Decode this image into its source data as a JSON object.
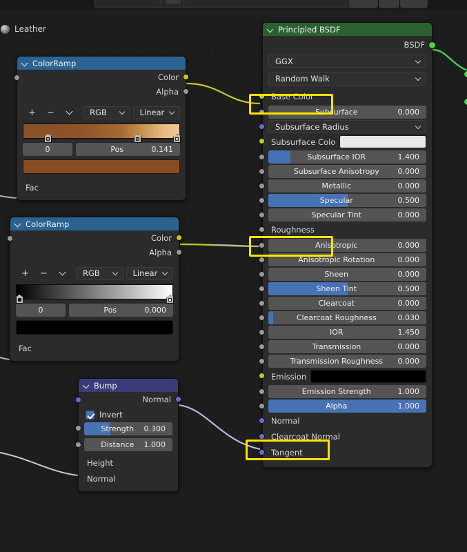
{
  "app": {
    "editor": "shader-node-editor"
  },
  "breadcrumb": {
    "material": "Leather",
    "icon": "material-ball-icon"
  },
  "colors": {
    "header_colorramp": "#2a6391",
    "header_bsdf": "#2b6130",
    "header_bump": "#3b3b7a",
    "slider_fill": "#4772b3",
    "highlight": "#ffe400",
    "socket_color": "#c7c729",
    "socket_gray": "#9a9a9a",
    "socket_green": "#4dcf53",
    "socket_vector": "#6b6bd8",
    "ramp1_start": "#8a5227",
    "ramp1_mid": "#8a5227",
    "ramp1_end": "#f0c893",
    "ramp2_start": "#000000",
    "ramp2_end": "#ffffff",
    "swatch1": "#8a4d23",
    "swatch2": "#000000",
    "emission_swatch": "#000000",
    "subsurface_color_swatch": "#e8e8e8"
  },
  "nodes": {
    "colorramp_top": {
      "title": "ColorRamp",
      "outputs": [
        {
          "label": "Color",
          "socket": "color-socket"
        },
        {
          "label": "Alpha",
          "socket": "gray-socket"
        }
      ],
      "tools": {
        "add": "+",
        "remove": "−",
        "menu": "chevron-down-icon"
      },
      "selects": {
        "interpolation_space": "RGB",
        "interpolation": "Linear"
      },
      "stops": [
        {
          "pos_pct": 16,
          "color": "#b5804a",
          "selected": true
        },
        {
          "pos_pct": 73,
          "color": "#a06a38",
          "selected": false
        },
        {
          "pos_pct": 98,
          "color": "#f0b97e",
          "selected": false
        }
      ],
      "index_value": "0",
      "pos_label": "Pos",
      "pos_value": "0.141",
      "swatch": "#8a4d23",
      "inputs": [
        {
          "label": "Fac",
          "socket": "gray-socket"
        }
      ]
    },
    "colorramp_bottom": {
      "title": "ColorRamp",
      "outputs": [
        {
          "label": "Color",
          "socket": "color-socket"
        },
        {
          "label": "Alpha",
          "socket": "gray-socket"
        }
      ],
      "tools": {
        "add": "+",
        "remove": "−",
        "menu": "chevron-down-icon"
      },
      "selects": {
        "interpolation_space": "RGB",
        "interpolation": "Linear"
      },
      "stops": [
        {
          "pos_pct": 2,
          "color": "#111111",
          "selected": true
        },
        {
          "pos_pct": 98,
          "color": "#ffffff",
          "selected": false
        }
      ],
      "index_value": "0",
      "pos_label": "Pos",
      "pos_value": "0.000",
      "swatch": "#000000",
      "inputs": [
        {
          "label": "Fac",
          "socket": "gray-socket"
        }
      ]
    },
    "bump": {
      "title": "Bump",
      "outputs": [
        {
          "label": "Normal",
          "socket": "vector-socket"
        }
      ],
      "invert": {
        "label": "Invert",
        "checked": true
      },
      "sliders": [
        {
          "label": "Strength",
          "value": "0.300",
          "fill_pct": 30
        },
        {
          "label": "Distance",
          "value": "1.000",
          "fill_pct": 0
        }
      ],
      "inputs": [
        {
          "label": "Height",
          "socket": "gray-socket"
        },
        {
          "label": "Normal",
          "socket": "vector-socket"
        }
      ]
    },
    "principled": {
      "title": "Principled BSDF",
      "output": {
        "label": "BSDF",
        "socket": "green-socket"
      },
      "dropdowns": [
        {
          "name": "distribution",
          "value": "GGX"
        },
        {
          "name": "subsurface-method",
          "value": "Random Walk"
        }
      ],
      "rows": [
        {
          "label": "Base Color",
          "kind": "socket-only",
          "socket": "color-socket",
          "highlighted": true
        },
        {
          "label": "Subsurface",
          "kind": "slider",
          "value": "0.000",
          "fill_pct": 0,
          "socket": "gray-socket"
        },
        {
          "label": "Subsurface Radius",
          "kind": "dropdown",
          "socket": "vector-socket"
        },
        {
          "label": "Subsurface Colo",
          "kind": "swatch",
          "swatch": "#e8e8e8",
          "socket": "color-socket"
        },
        {
          "label": "Subsurface IOR",
          "kind": "slider",
          "value": "1.400",
          "fill_pct": 14,
          "socket": "gray-socket"
        },
        {
          "label": "Subsurface Anisotropy",
          "kind": "slider",
          "value": "0.000",
          "fill_pct": 0,
          "socket": "gray-socket"
        },
        {
          "label": "Metallic",
          "kind": "slider",
          "value": "0.000",
          "fill_pct": 0,
          "socket": "gray-socket"
        },
        {
          "label": "Specular",
          "kind": "slider",
          "value": "0.500",
          "fill_pct": 50,
          "socket": "gray-socket"
        },
        {
          "label": "Specular Tint",
          "kind": "slider",
          "value": "0.000",
          "fill_pct": 0,
          "socket": "gray-socket"
        },
        {
          "label": "Roughness",
          "kind": "socket-only",
          "socket": "gray-socket",
          "highlighted": true
        },
        {
          "label": "Anisotropic",
          "kind": "slider",
          "value": "0.000",
          "fill_pct": 0,
          "socket": "gray-socket"
        },
        {
          "label": "Anisotropic Rotation",
          "kind": "slider",
          "value": "0.000",
          "fill_pct": 0,
          "socket": "gray-socket"
        },
        {
          "label": "Sheen",
          "kind": "slider",
          "value": "0.000",
          "fill_pct": 0,
          "socket": "gray-socket"
        },
        {
          "label": "Sheen Tint",
          "kind": "slider",
          "value": "0.500",
          "fill_pct": 50,
          "socket": "gray-socket"
        },
        {
          "label": "Clearcoat",
          "kind": "slider",
          "value": "0.000",
          "fill_pct": 0,
          "socket": "gray-socket"
        },
        {
          "label": "Clearcoat Roughness",
          "kind": "slider",
          "value": "0.030",
          "fill_pct": 3,
          "socket": "gray-socket"
        },
        {
          "label": "IOR",
          "kind": "slider",
          "value": "1.450",
          "fill_pct": 0,
          "socket": "gray-socket"
        },
        {
          "label": "Transmission",
          "kind": "slider",
          "value": "0.000",
          "fill_pct": 0,
          "socket": "gray-socket"
        },
        {
          "label": "Transmission Roughness",
          "kind": "slider",
          "value": "0.000",
          "fill_pct": 0,
          "socket": "gray-socket"
        },
        {
          "label": "Emission",
          "kind": "swatch",
          "swatch": "#000000",
          "socket": "color-socket"
        },
        {
          "label": "Emission Strength",
          "kind": "slider",
          "value": "1.000",
          "fill_pct": 0,
          "socket": "gray-socket"
        },
        {
          "label": "Alpha",
          "kind": "slider",
          "value": "1.000",
          "fill_pct": 100,
          "socket": "gray-socket"
        },
        {
          "label": "Normal",
          "kind": "socket-only",
          "socket": "vector-socket",
          "highlighted": true
        },
        {
          "label": "Clearcoat Normal",
          "kind": "socket-only",
          "socket": "vector-socket"
        },
        {
          "label": "Tangent",
          "kind": "socket-only",
          "socket": "vector-socket"
        }
      ]
    }
  },
  "highlights": [
    {
      "target": "base-color-row"
    },
    {
      "target": "roughness-row"
    },
    {
      "target": "normal-row"
    }
  ],
  "links": [
    {
      "from": "colorramp_top.Color",
      "to": "principled.Base Color",
      "color": "#c7c729"
    },
    {
      "from": "colorramp_bottom.Color",
      "to": "principled.Roughness",
      "color": "#c7c729"
    },
    {
      "from": "bump.Normal",
      "to": "principled.Normal",
      "color": "#b7b7d8"
    },
    {
      "from": "principled.BSDF",
      "to": "output.Surface",
      "color": "#4dcf53"
    }
  ]
}
